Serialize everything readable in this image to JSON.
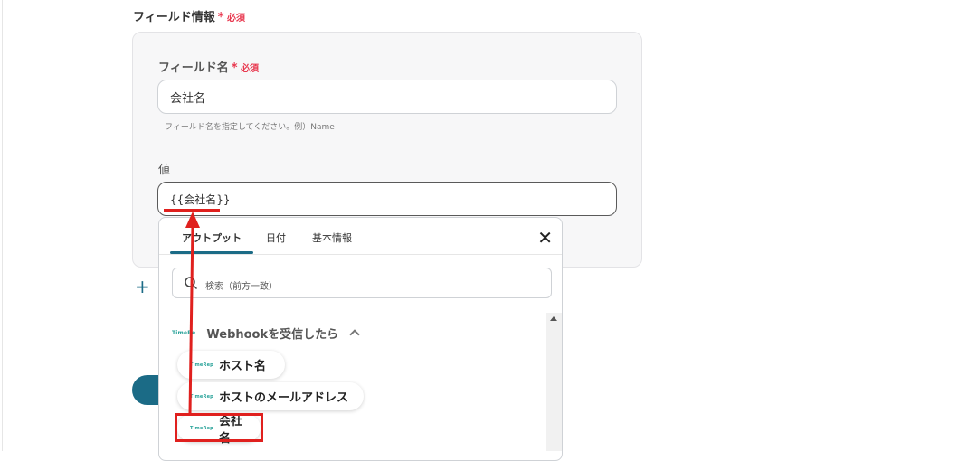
{
  "section": {
    "title": "フィールド情報",
    "required": "必須",
    "asterisk": "*"
  },
  "field_name": {
    "label": "フィールド名",
    "required": "必須",
    "asterisk": "*",
    "value": "会社名",
    "hint": "フィールド名を指定してください。例）Name"
  },
  "value_field": {
    "label": "値",
    "value": "{{会社名}}"
  },
  "add_button": {
    "label": "+"
  },
  "dropdown": {
    "tabs": [
      "アウトプット",
      "日付",
      "基本情報"
    ],
    "active_tab": "アウトプット",
    "close": "✕",
    "search_placeholder": "検索（前方一致）",
    "group": {
      "logo": "TimeRe",
      "title": "Webhookを受信したら"
    },
    "items": [
      {
        "logo": "TimeRep",
        "label": "ホスト名"
      },
      {
        "logo": "TimeRep",
        "label": "ホストのメールアドレス"
      },
      {
        "logo": "TimeRep",
        "label": "会社名"
      }
    ]
  },
  "colors": {
    "accent": "#1b6b86",
    "required": "#e8384f",
    "annotation": "#e0201e"
  }
}
